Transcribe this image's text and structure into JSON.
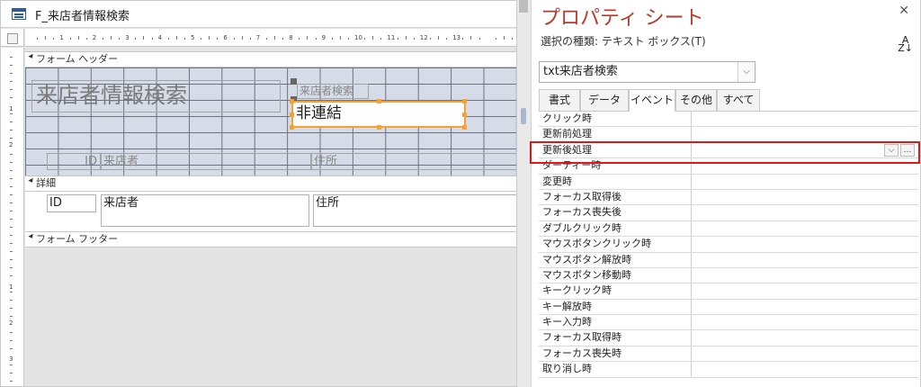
{
  "designer": {
    "tab_title": "F_来店者情報検索",
    "sections": {
      "form_header": "フォーム ヘッダー",
      "detail": "詳細",
      "form_footer": "フォーム フッター"
    },
    "ruler_numbers": [
      "1",
      "2",
      "3",
      "4",
      "5",
      "6",
      "7",
      "8",
      "9",
      "10",
      "11",
      "12",
      "13"
    ],
    "vruler_numbers": [
      "1",
      "2",
      "1",
      "2",
      "3"
    ],
    "header_controls": {
      "title_label": "来店者情報検索",
      "search_label": "来店者検索",
      "unbound_text": "非連結",
      "col_id": "ID",
      "col_visitor": "来店者",
      "col_address": "住所"
    },
    "detail_controls": {
      "id": "ID",
      "visitor": "来店者",
      "address": "住所"
    }
  },
  "property_sheet": {
    "title": "プロパティ シート",
    "selection_type": "選択の種類: テキスト ボックス(T)",
    "close_glyph": "✕",
    "selected_object": "txt来店者検索",
    "tabs": [
      {
        "label": "書式",
        "active": false
      },
      {
        "label": "データ",
        "active": false
      },
      {
        "label": "イベント",
        "active": true
      },
      {
        "label": "その他",
        "active": false
      },
      {
        "label": "すべて",
        "active": false
      }
    ],
    "rows": [
      "クリック時",
      "更新前処理",
      "更新後処理",
      "ダーティー時",
      "変更時",
      "フォーカス取得後",
      "フォーカス喪失後",
      "ダブルクリック時",
      "マウスボタンクリック時",
      "マウスボタン解放時",
      "マウスボタン移動時",
      "キークリック時",
      "キー解放時",
      "キー入力時",
      "フォーカス取得時",
      "フォーカス喪失時",
      "取り消し時"
    ],
    "highlighted_row": "更新後処理",
    "highlight_color": "#e0161b"
  }
}
